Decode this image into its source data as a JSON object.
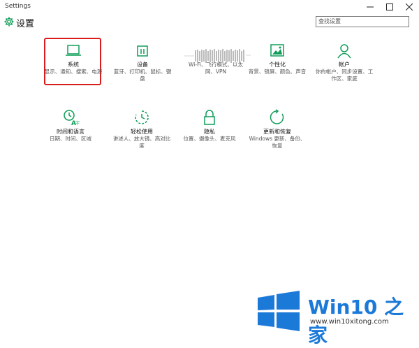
{
  "window": {
    "title": "Settings",
    "controls": {
      "minimize": "—",
      "maximize": "☐",
      "close": "✕"
    }
  },
  "header": {
    "title": "设置",
    "search_placeholder": "查找设置"
  },
  "tiles": [
    {
      "name": "系统",
      "desc": "显示、通知、搜索、电源",
      "icon": "laptop-icon"
    },
    {
      "name": "设备",
      "desc": "蓝牙、打印机、鼠标、键盘",
      "icon": "devices-icon"
    },
    {
      "name": "",
      "desc": "Wi-Fi、飞行模式、以太网、VPN",
      "icon": "globe-icon"
    },
    {
      "name": "个性化",
      "desc": "背景、锁屏、颜色、声音",
      "icon": "personalization-icon"
    },
    {
      "name": "帐户",
      "desc": "你的帐户、同步设置、工作区、家庭",
      "icon": "person-icon"
    },
    {
      "name": "时间和语言",
      "desc": "日期、时间、区域",
      "icon": "time-language-icon"
    },
    {
      "name": "轻松使用",
      "desc": "讲述人、放大镜、高对比度",
      "icon": "ease-of-access-icon"
    },
    {
      "name": "隐私",
      "desc": "位置、摄像头、麦克风",
      "icon": "lock-icon"
    },
    {
      "name": "更新和恢复",
      "desc": "Windows 更新、备份、恢复",
      "icon": "refresh-icon"
    }
  ],
  "watermark": {
    "brand": "Win10 之家",
    "url": "www.win10xitong.com"
  },
  "colors": {
    "accent": "#0f9d58",
    "selection": "#d91d1d",
    "brand": "#1b79d8"
  }
}
